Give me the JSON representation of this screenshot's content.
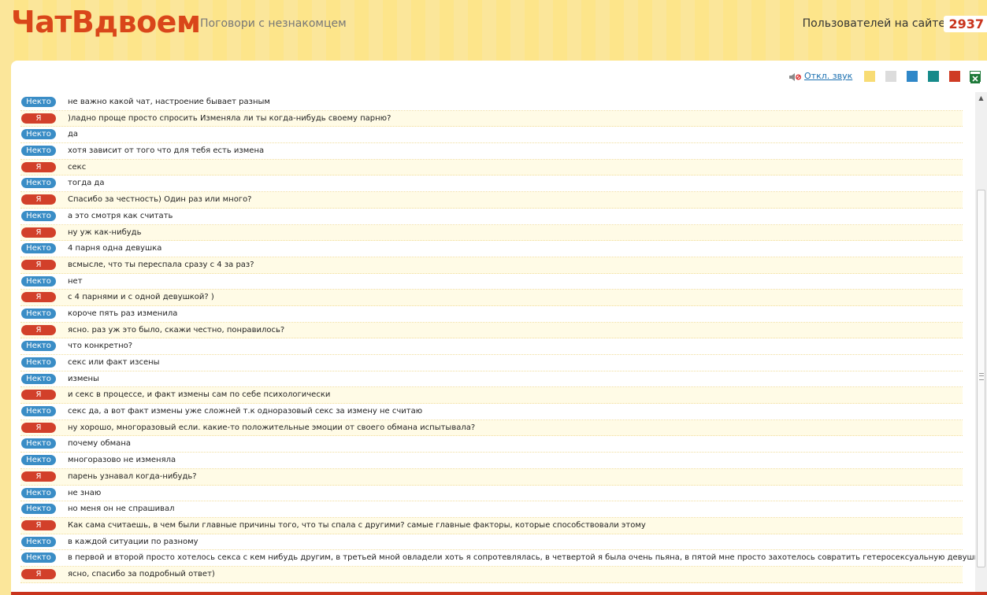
{
  "header": {
    "logo": "ЧатВдвоем",
    "slogan": "Поговори с незнакомцем",
    "users_label": "Пользователей на сайте",
    "users_count": "2937"
  },
  "toolbar": {
    "sound_label": "Откл. звук",
    "sound_icon": "speaker-mute-icon",
    "swatches": [
      {
        "name": "yellow",
        "color": "#f8dc74"
      },
      {
        "name": "gray",
        "color": "#dcdcdc"
      },
      {
        "name": "blue",
        "color": "#2f87c8"
      },
      {
        "name": "teal",
        "color": "#168a8a"
      },
      {
        "name": "red",
        "color": "#cf3b24"
      },
      {
        "name": "excel",
        "color": "#1f7a3a"
      }
    ]
  },
  "labels": {
    "stranger": "Некто",
    "self": "Я"
  },
  "messages": [
    {
      "who": "stranger",
      "text": "не важно какой чат, настроение бывает разным"
    },
    {
      "who": "self",
      "text": ")ладно проще просто спросить Изменяла ли ты когда-нибудь своему парню?"
    },
    {
      "who": "stranger",
      "text": "да"
    },
    {
      "who": "stranger",
      "text": "хотя зависит от того что для тебя есть измена"
    },
    {
      "who": "self",
      "text": "секс"
    },
    {
      "who": "stranger",
      "text": "тогда да"
    },
    {
      "who": "self",
      "text": "Спасибо за честность) Один раз или много?"
    },
    {
      "who": "stranger",
      "text": "а это смотря как считать"
    },
    {
      "who": "self",
      "text": "ну уж как-нибудь"
    },
    {
      "who": "stranger",
      "text": "4 парня одна девушка"
    },
    {
      "who": "self",
      "text": "всмысле, что ты переспала сразу с 4 за раз?"
    },
    {
      "who": "stranger",
      "text": "нет"
    },
    {
      "who": "self",
      "text": "с 4 парнями и с одной девушкой? )"
    },
    {
      "who": "stranger",
      "text": "короче пять раз изменила"
    },
    {
      "who": "self",
      "text": "ясно. раз уж это было, скажи честно, понравилось?"
    },
    {
      "who": "stranger",
      "text": "что конкретно?"
    },
    {
      "who": "stranger",
      "text": "секс или факт изсены"
    },
    {
      "who": "stranger",
      "text": "измены"
    },
    {
      "who": "self",
      "text": "и секс в процессе, и факт измены сам по себе психологически"
    },
    {
      "who": "stranger",
      "text": "секс да, а вот факт измены уже сложней т.к одноразовый секс за измену не считаю"
    },
    {
      "who": "self",
      "text": "ну хорошо, многоразовый если. какие-то положительные эмоции от своего обмана испытывала?"
    },
    {
      "who": "stranger",
      "text": "почему обмана"
    },
    {
      "who": "stranger",
      "text": "многоразово не изменяла"
    },
    {
      "who": "self",
      "text": "парень узнавал когда-нибудь?"
    },
    {
      "who": "stranger",
      "text": "не знаю"
    },
    {
      "who": "stranger",
      "text": "но меня он не спрашивал"
    },
    {
      "who": "self",
      "text": "Как сама считаешь, в чем были главные причины того, что ты спала с другими? самые главные факторы, которые способствовали этому"
    },
    {
      "who": "stranger",
      "text": "в каждой ситуации по разному"
    },
    {
      "who": "stranger",
      "text": "в первой и второй просто хотелось секса с кем нибудь другим, в третьей мной овладели хоть я сопротевлялась, в четвертой я была очень пьяна, в пятой мне просто захотелось совратить гетеросексуальную девушку"
    },
    {
      "who": "self",
      "text": "ясно, спасибо за подробный ответ)"
    }
  ]
}
